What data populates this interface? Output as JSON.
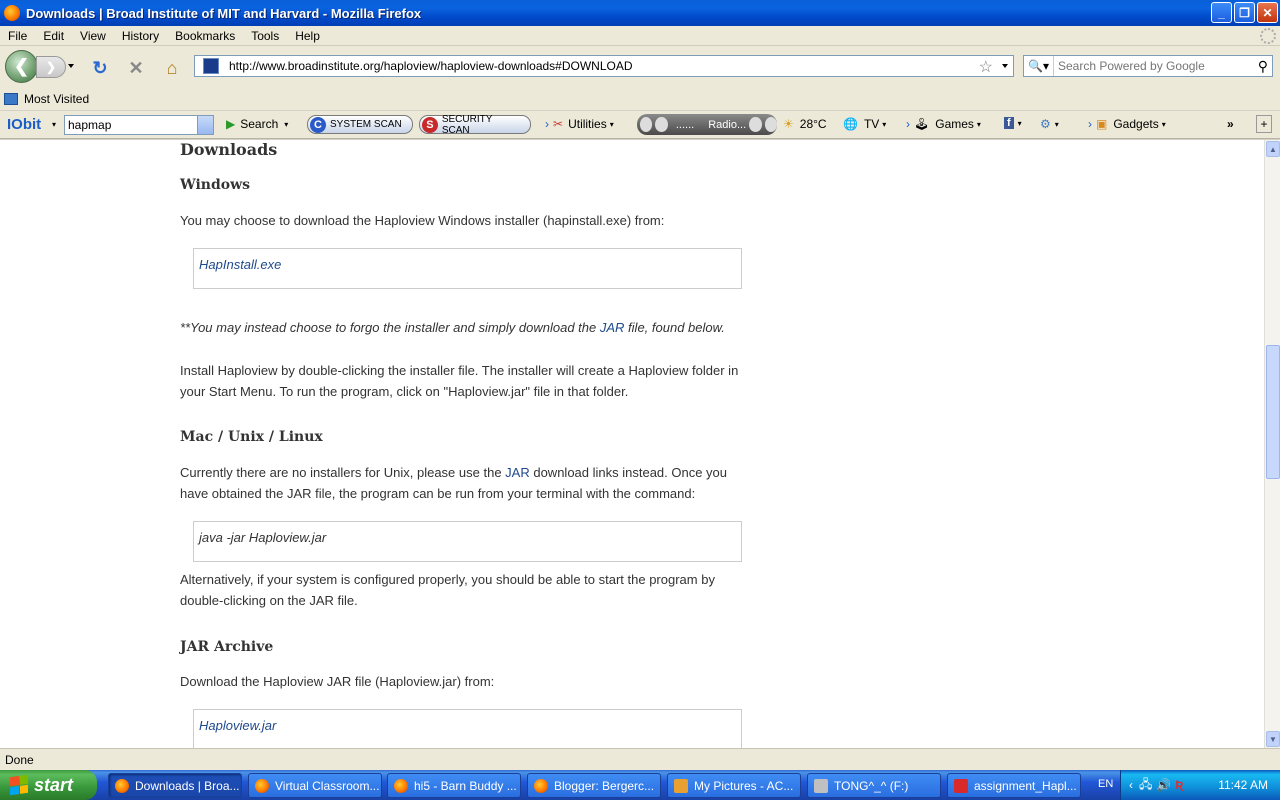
{
  "window": {
    "title": "Downloads | Broad Institute of MIT and Harvard - Mozilla Firefox",
    "controls": {
      "minimize": "_",
      "maximize": "❐",
      "close": "✕"
    }
  },
  "menu": [
    "File",
    "Edit",
    "View",
    "History",
    "Bookmarks",
    "Tools",
    "Help"
  ],
  "nav": {
    "url": "http://www.broadinstitute.org/haploview/haploview-downloads#DOWNLOAD",
    "search_placeholder": "Search Powered by Google"
  },
  "bookmarks": {
    "most_visited": "Most Visited"
  },
  "iobit": {
    "logo": "IObit",
    "combo_value": "hapmap",
    "search": "Search",
    "system_scan": "SYSTEM SCAN",
    "security_scan": "SECURITY SCAN",
    "utilities": "Utilities",
    "radio": "Radio...",
    "radio_dots": "......",
    "temp": "28°C",
    "tv": "TV",
    "games": "Games",
    "gadgets": "Gadgets",
    "more": "»",
    "add": "+"
  },
  "page": {
    "heading": "Downloads",
    "windows": {
      "title": "Windows",
      "intro": "You may choose to download the Haploview Windows installer (hapinstall.exe) from:",
      "link": "HapInstall.exe",
      "note_prefix": "**You may instead choose to forgo the installer and simply download the ",
      "note_link": "JAR",
      "note_suffix": " file, found below.",
      "install": "Install Haploview by double-clicking the installer file. The installer will create a Haploview folder in your Start Menu. To run the program, click on \"Haploview.jar\" file in that folder."
    },
    "unix": {
      "title": "Mac / Unix / Linux",
      "p1_prefix": "Currently there are no installers for Unix, please use the ",
      "p1_link": "JAR",
      "p1_suffix": " download links instead. Once you have obtained the JAR file, the program can be run from your terminal with the command:",
      "command": "java -jar Haploview.jar",
      "p2": "Alternatively, if your system is configured properly, you should be able to start the program by double-clicking on the JAR file."
    },
    "jar": {
      "title": "JAR Archive",
      "intro": "Download the Haploview JAR file (Haploview.jar) from:",
      "link": "Haploview.jar"
    }
  },
  "status": "Done",
  "taskbar": {
    "start": "start",
    "tasks": [
      "Downloads | Broa...",
      "Virtual Classroom...",
      "hi5 - Barn Buddy ...",
      "Blogger: Bergerc...",
      "My Pictures - AC...",
      "TONG^_^ (F:)",
      "assignment_Hapl..."
    ],
    "lang": "EN",
    "clock": "11:42 AM"
  }
}
